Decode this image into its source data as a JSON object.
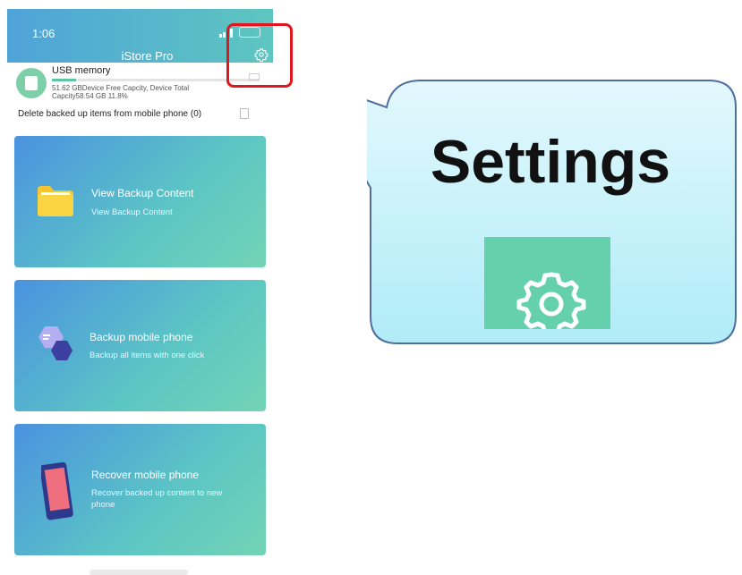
{
  "status_bar": {
    "time": "1:06"
  },
  "header": {
    "title": "iStore Pro",
    "settings_icon": "gear-icon"
  },
  "usb": {
    "title": "USB memory",
    "detail": "51.62 GBDevice Free Capcity, Device Total Capcity58.54 GB 11.8%",
    "used_fraction": 0.118
  },
  "delete_row": {
    "label": "Delete backed up items from mobile phone (0)"
  },
  "cards": [
    {
      "title": "View Backup Content",
      "subtitle": "View Backup Content",
      "icon": "folder-icon"
    },
    {
      "title": "Backup mobile phone",
      "subtitle": "Backup all items with one click",
      "icon": "backup-hexagon-icon"
    },
    {
      "title": "Recover mobile phone",
      "subtitle": "Recover backed up content to new phone",
      "icon": "smartphone-icon"
    }
  ],
  "callout": {
    "title": "Settings",
    "icon": "gear-icon"
  },
  "colors": {
    "accent_start": "#4a92e0",
    "accent_end": "#73d3b4",
    "highlight": "#e0171f",
    "callout_fill": "#c9f1fb"
  }
}
